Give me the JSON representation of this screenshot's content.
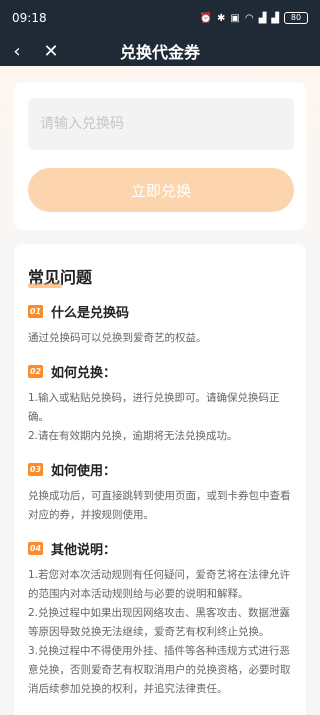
{
  "status_bar": {
    "time": "09:18",
    "icons": [
      "alarm-icon",
      "bluetooth-icon",
      "hd-icon",
      "wifi-icon",
      "signal-icon",
      "signal-icon"
    ],
    "battery": "80"
  },
  "nav": {
    "back_icon": "‹",
    "close_icon": "✕",
    "title": "兑换代金券"
  },
  "redeem": {
    "placeholder": "请输入兑换码",
    "button_label": "立即兑换"
  },
  "faq": {
    "title": "常见问题",
    "items": [
      {
        "num": "01",
        "question": "什么是兑换码",
        "answer": [
          "通过兑换码可以兑换到爱奇艺的权益。"
        ]
      },
      {
        "num": "02",
        "question": "如何兑换：",
        "answer": [
          "1.输入或粘贴兑换码，进行兑换即可。请确保兑换码正确。",
          "2.请在有效期内兑换，逾期将无法兑换成功。"
        ]
      },
      {
        "num": "03",
        "question": "如何使用：",
        "answer": [
          "兑换成功后，可直接跳转到使用页面，或到卡券包中查看对应的券，并按规则使用。"
        ]
      },
      {
        "num": "04",
        "question": "其他说明：",
        "answer": [
          "1.若您对本次活动规则有任何疑问，爱奇艺将在法律允许的范围内对本活动规则给与必要的说明和解释。",
          "2.兑换过程中如果出现因网络攻击、黑客攻击、数据泄露等原因导致兑换无法继续，爱奇艺有权利终止兑换。",
          "3.兑换过程中不得使用外挂、插件等各种违规方式进行恶意兑换，否则爱奇艺有权取消用户的兑换资格，必要时取消后续参加兑换的权利，并追究法律责任。"
        ]
      }
    ]
  },
  "colors": {
    "accent": "#ff8a2a",
    "button_disabled": "#fcd5ae",
    "header_bg": "#1f2a36"
  }
}
